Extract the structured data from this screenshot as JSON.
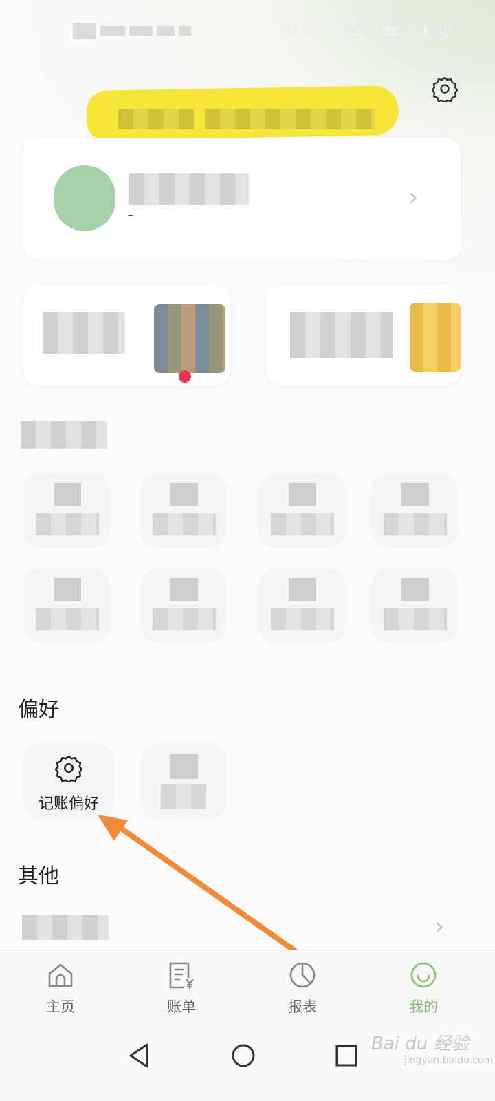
{
  "status_bar": {
    "battery": "61%",
    "time": "11:38"
  },
  "sections": {
    "preferences_title": "偏好",
    "other_title": "其他"
  },
  "preferences": {
    "bookkeeping_label": "记账偏好"
  },
  "bottom_nav": {
    "items": [
      {
        "label": "主页",
        "icon": "home-icon"
      },
      {
        "label": "账单",
        "icon": "bill-icon"
      },
      {
        "label": "报表",
        "icon": "report-icon"
      },
      {
        "label": "我的",
        "icon": "profile-icon"
      }
    ],
    "active_index": 3
  },
  "colors": {
    "accent_green": "#8fc27a",
    "highlight_yellow": "#f6e63a",
    "annotation_orange": "#f28a3a"
  }
}
